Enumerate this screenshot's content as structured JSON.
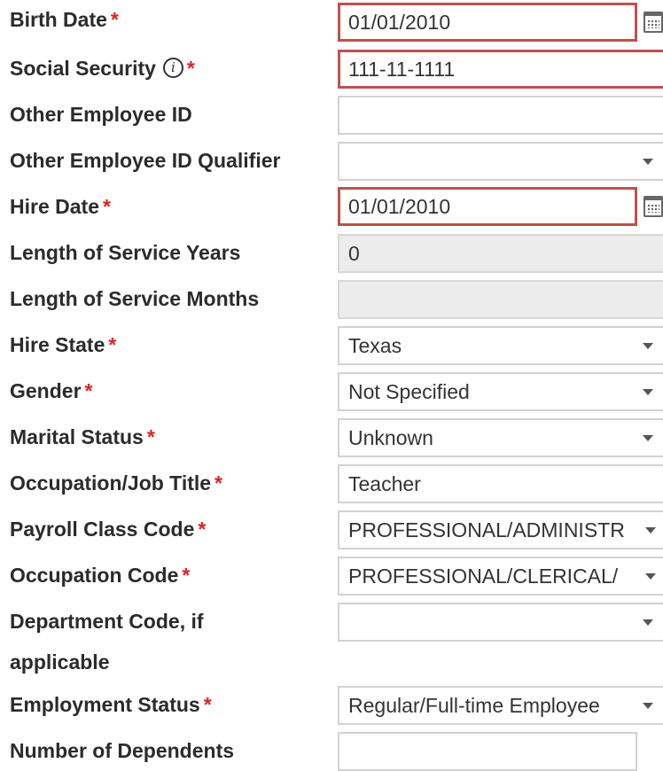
{
  "form": {
    "birth_date": {
      "label": "Birth Date",
      "required_mark": "*",
      "value": "01/01/2010",
      "icon": "calendar-icon"
    },
    "social_security": {
      "label": "Social Security",
      "required_mark": "*",
      "info_glyph": "i",
      "value": "111-11-1111"
    },
    "other_employee_id": {
      "label": "Other Employee ID",
      "value": ""
    },
    "other_employee_id_qualifier": {
      "label": "Other Employee ID Qualifier",
      "value": ""
    },
    "hire_date": {
      "label": "Hire Date",
      "required_mark": "*",
      "value": "01/01/2010",
      "icon": "calendar-icon"
    },
    "length_of_service_years": {
      "label": "Length of Service Years",
      "value": "0"
    },
    "length_of_service_months": {
      "label": "Length of Service Months",
      "value": ""
    },
    "hire_state": {
      "label": "Hire State",
      "required_mark": "*",
      "value": "Texas"
    },
    "gender": {
      "label": "Gender",
      "required_mark": "*",
      "value": "Not Specified"
    },
    "marital_status": {
      "label": "Marital Status",
      "required_mark": "*",
      "value": "Unknown"
    },
    "occupation_job_title": {
      "label": "Occupation/Job Title",
      "required_mark": "*",
      "value": "Teacher"
    },
    "payroll_class_code": {
      "label": "Payroll Class Code",
      "required_mark": "*",
      "value": "PROFESSIONAL/ADMINISTR"
    },
    "occupation_code": {
      "label": "Occupation Code",
      "required_mark": "*",
      "value": "PROFESSIONAL/CLERICAL/"
    },
    "department_code": {
      "label_line1": "Department Code, if",
      "label_line2": "applicable",
      "value": ""
    },
    "employment_status": {
      "label": "Employment Status",
      "required_mark": "*",
      "value": "Regular/Full-time Employee"
    },
    "number_of_dependents": {
      "label": "Number of Dependents",
      "value": ""
    }
  },
  "colors": {
    "required": "#e02020",
    "highlight_border": "#c0504d",
    "readonly_bg": "#ececec"
  }
}
